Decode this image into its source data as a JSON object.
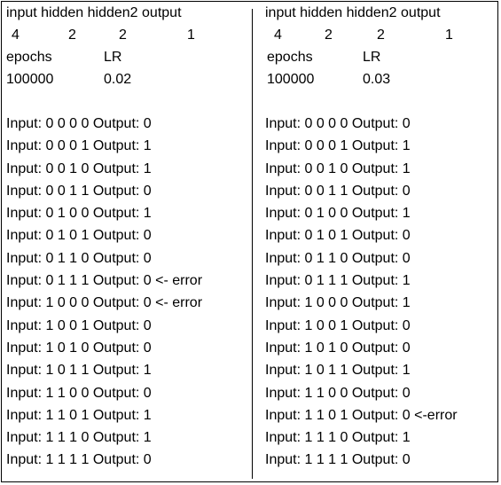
{
  "left": {
    "header": "input hidden hidden2 output",
    "layers": [
      "4",
      "2",
      "2",
      "1"
    ],
    "params_labels": [
      "epochs",
      "LR"
    ],
    "params_values": [
      "100000",
      "0.02"
    ],
    "results": [
      "Input: 0 0 0 0 Output: 0",
      "Input: 0 0 0 1 Output: 1",
      "Input: 0 0 1 0 Output: 1",
      "Input: 0 0 1 1 Output: 0",
      "Input: 0 1 0 0 Output: 1",
      "Input: 0 1 0 1 Output: 0",
      "Input: 0 1 1 0 Output: 0",
      "Input: 0 1 1 1 Output: 0 <- error",
      "Input: 1 0 0 0 Output: 0 <- error",
      "Input: 1 0 0 1 Output: 0",
      "Input: 1 0 1 0 Output: 0",
      "Input: 1 0 1 1 Output: 1",
      "Input: 1 1 0 0 Output: 0",
      "Input: 1 1 0 1 Output: 1",
      "Input: 1 1 1 0 Output: 1",
      "Input: 1 1 1 1 Output: 0"
    ]
  },
  "right": {
    "header": "input hidden hidden2 output",
    "layers": [
      "4",
      "2",
      "2",
      "1"
    ],
    "params_labels": [
      "epochs",
      "LR"
    ],
    "params_values": [
      "100000",
      "0.03"
    ],
    "results": [
      "Input: 0 0 0 0 Output: 0",
      "Input: 0 0 0 1 Output: 1",
      "Input: 0 0 1 0 Output: 1",
      "Input: 0 0 1 1 Output: 0",
      "Input: 0 1 0 0 Output: 1",
      "Input: 0 1 0 1 Output: 0",
      "Input: 0 1 1 0 Output: 0",
      "Input: 0 1 1 1 Output: 1",
      "Input: 1 0 0 0 Output: 1",
      "Input: 1 0 0 1 Output: 0",
      "Input: 1 0 1 0 Output: 0",
      "Input: 1 0 1 1 Output: 1",
      "Input: 1 1 0 0 Output: 0",
      "Input: 1 1 0 1 Output: 0 <-error",
      "Input: 1 1 1 0 Output: 1",
      "Input: 1 1 1 1 Output: 0"
    ]
  }
}
